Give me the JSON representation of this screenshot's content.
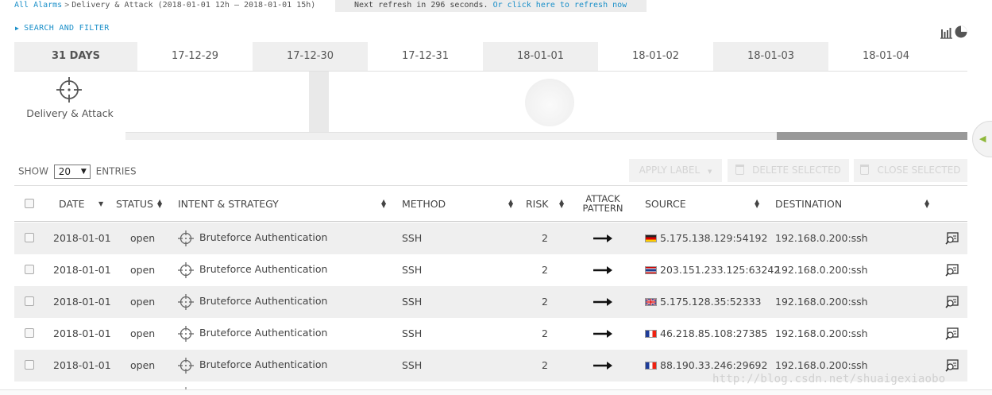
{
  "breadcrumb": {
    "root": "All Alarms",
    "separator": ">",
    "current": "Delivery & Attack (2018-01-01 12h — 2018-01-01 15h)"
  },
  "refresh": {
    "text": "Next refresh in 296 seconds.",
    "link": "Or click here to refresh now"
  },
  "search_filter": {
    "label": "SEARCH AND FILTER",
    "icon": "triangle-right-icon"
  },
  "chart_toggle": {
    "icon": "bar-pie-chart-icon"
  },
  "timeline": {
    "tabs": [
      "31 DAYS",
      "17-12-29",
      "17-12-30",
      "17-12-31",
      "18-01-01",
      "18-01-02",
      "18-01-03",
      "18-01-04"
    ],
    "intent_label": "Delivery & Attack",
    "intent_icon": "crosshair-icon"
  },
  "controls": {
    "show_label": "SHOW",
    "page_size": "20",
    "entries_label": "ENTRIES",
    "apply_label": "APPLY LABEL",
    "delete_selected": "DELETE SELECTED",
    "close_selected": "CLOSE SELECTED"
  },
  "table": {
    "columns": {
      "date": "DATE",
      "status": "STATUS",
      "intent": "INTENT & STRATEGY",
      "method": "METHOD",
      "risk": "RISK",
      "attack_pattern_1": "ATTACK",
      "attack_pattern_2": "PATTERN",
      "source": "SOURCE",
      "destination": "DESTINATION"
    },
    "rows": [
      {
        "date": "2018-01-01",
        "status": "open",
        "intent": "Bruteforce Authentication",
        "method": "SSH",
        "risk": "2",
        "source": "5.175.138.129:54192",
        "flag": "de",
        "destination": "192.168.0.200:ssh"
      },
      {
        "date": "2018-01-01",
        "status": "open",
        "intent": "Bruteforce Authentication",
        "method": "SSH",
        "risk": "2",
        "source": "203.151.233.125:63242",
        "flag": "th",
        "destination": "192.168.0.200:ssh"
      },
      {
        "date": "2018-01-01",
        "status": "open",
        "intent": "Bruteforce Authentication",
        "method": "SSH",
        "risk": "2",
        "source": "5.175.128.35:52333",
        "flag": "gb",
        "destination": "192.168.0.200:ssh"
      },
      {
        "date": "2018-01-01",
        "status": "open",
        "intent": "Bruteforce Authentication",
        "method": "SSH",
        "risk": "2",
        "source": "46.218.85.108:27385",
        "flag": "fr",
        "destination": "192.168.0.200:ssh"
      },
      {
        "date": "2018-01-01",
        "status": "open",
        "intent": "Bruteforce Authentication",
        "method": "SSH",
        "risk": "2",
        "source": "88.190.33.246:29692",
        "flag": "fr",
        "destination": "192.168.0.200:ssh"
      }
    ]
  },
  "watermark": "http://blog.csdn.net/shuaigexiaobo",
  "colors": {
    "link": "#1a8fc9",
    "row_alt": "#efefef",
    "scroll_thumb": "#999999",
    "handle_arrow": "#8fb83a"
  }
}
